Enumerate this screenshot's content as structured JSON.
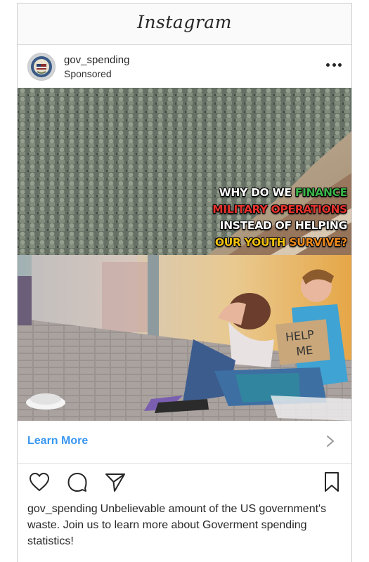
{
  "app": {
    "title": "Instagram"
  },
  "post": {
    "username": "gov_spending",
    "sponsored_label": "Sponsored",
    "image": {
      "top_caption": {
        "line1": [
          "WHY DO WE ",
          "FINANCE"
        ],
        "line2": "MILITARY OPERATIONS",
        "line3": "INSTEAD OF HELPING",
        "line4": [
          "OUR YOUTH ",
          "SURVIVE?"
        ]
      },
      "sign_text": "HELP ME"
    },
    "cta_label": "Learn More",
    "caption_username": "gov_spending",
    "caption_text": "Unbelievable amount of the US government's waste. Join us to learn more about Goverment spending statistics!"
  },
  "icons": [
    "heart-icon",
    "comment-icon",
    "share-icon",
    "bookmark-icon",
    "more-icon",
    "chevron-right-icon"
  ],
  "colors": {
    "link_blue": "#3897f0",
    "text": "#262626",
    "meme_green": "#3bb54a",
    "meme_red": "#e8322d",
    "meme_yellow": "#f4c20d",
    "meme_orange": "#f08a1c"
  }
}
